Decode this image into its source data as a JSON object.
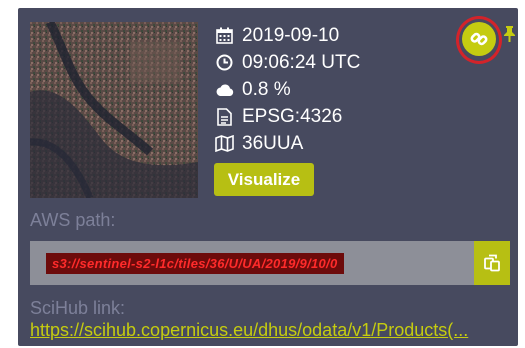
{
  "thumbnail": {
    "alt": "sentinel-2 preview"
  },
  "meta": {
    "date": "2019-09-10",
    "time": "09:06:24 UTC",
    "cloud": "0.8 %",
    "crs": "EPSG:4326",
    "tile": "36UUA"
  },
  "actions": {
    "visualize_label": "Visualize"
  },
  "aws": {
    "label": "AWS path:",
    "value": "s3://sentinel-s2-l1c/tiles/36/U/UA/2019/9/10/0"
  },
  "scihub": {
    "label": "SciHub link:",
    "url": "https://scihub.copernicus.eu/dhus/odata/v1/Products(..."
  },
  "icons": [
    "calendar-icon",
    "clock-icon",
    "cloud-icon",
    "document-icon",
    "map-icon",
    "link-icon",
    "pin-icon",
    "copy-icon"
  ],
  "colors": {
    "panel": "#474a5f",
    "accent": "#b7bf13",
    "highlight_ring": "#d3232a"
  }
}
